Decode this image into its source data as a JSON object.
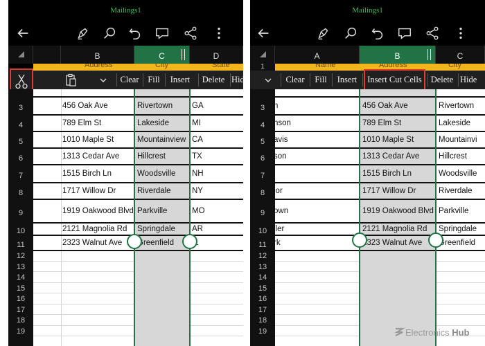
{
  "app": {
    "title": "Mailings1"
  },
  "toolbar_icons": [
    "back-arrow-icon",
    "pen-icon",
    "search-icon",
    "undo-icon",
    "comment-icon",
    "share-icon",
    "more-icon"
  ],
  "accent_color": "#217346",
  "highlight_color": "#e33b30",
  "left_panel": {
    "columns": [
      "B",
      "C",
      "D"
    ],
    "header_row": [
      "Address",
      "City",
      "State"
    ],
    "menu": [
      "Clear",
      "Fill",
      "Insert",
      "Delete",
      "Hide"
    ],
    "rows": [
      {
        "num": "3",
        "b": "456 Oak Ave",
        "c": "Rivertown",
        "d": "GA"
      },
      {
        "num": "4",
        "b": "789 Elm St",
        "c": "Lakeside",
        "d": "MI"
      },
      {
        "num": "5",
        "b": "1010 Maple St",
        "c": "Mountainview",
        "d": "CA"
      },
      {
        "num": "6",
        "b": "1313 Cedar Ave",
        "c": "Hillcrest",
        "d": "TX"
      },
      {
        "num": "7",
        "b": "1515 Birch Ln",
        "c": "Woodsville",
        "d": "NH"
      },
      {
        "num": "8",
        "b": "1717 Willow Dr",
        "c": "Riverdale",
        "d": "NY"
      },
      {
        "num": "9",
        "b": "1919 Oakwood Blvd",
        "c": "Parkville",
        "d": "MO"
      },
      {
        "num": "10",
        "b": "2121 Magnolia Rd",
        "c": "Springdale",
        "d": "AR"
      },
      {
        "num": "11",
        "b": "2323 Walnut Ave",
        "c": "Greenfield",
        "d": "IL"
      }
    ],
    "empty_rows": [
      "12",
      "13",
      "14",
      "15",
      "16",
      "17",
      "18",
      "19"
    ]
  },
  "right_panel": {
    "columns": [
      "A",
      "B",
      "C"
    ],
    "header_row": [
      "Name",
      "Address",
      "City"
    ],
    "row_one": "1",
    "menu": [
      "Clear",
      "Fill",
      "Insert",
      "Insert Cut Cells",
      "Delete",
      "Hide"
    ],
    "rows": [
      {
        "num": "3",
        "a": "n",
        "b": "456 Oak Ave",
        "c": "Rivertown"
      },
      {
        "num": "4",
        "a": "nson",
        "b": "789 Elm St",
        "c": "Lakeside"
      },
      {
        "num": "5",
        "a": "avis",
        "b": "1010 Maple St",
        "c": "Mountainvi"
      },
      {
        "num": "6",
        "a": "son",
        "b": "1313 Cedar Ave",
        "c": "Hillcrest"
      },
      {
        "num": "7",
        "a": "",
        "b": "1515 Birch Ln",
        "c": "Woodsville"
      },
      {
        "num": "8",
        "a": "lor",
        "b": "1717 Willow Dr",
        "c": "Riverdale"
      },
      {
        "num": "9",
        "a": "own",
        "b": "1919 Oakwood Blvd",
        "c": "Parkville"
      },
      {
        "num": "10",
        "a": "ller",
        "b": "2121 Magnolia Rd",
        "c": "Springdale"
      },
      {
        "num": "11",
        "a": "rk",
        "b": "2323 Walnut Ave",
        "c": "Greenfield"
      }
    ],
    "empty_rows": [
      "12",
      "13",
      "14",
      "15",
      "16",
      "17",
      "18",
      "19"
    ]
  },
  "watermark": {
    "text": "Electronics",
    "bold": "Hub"
  }
}
